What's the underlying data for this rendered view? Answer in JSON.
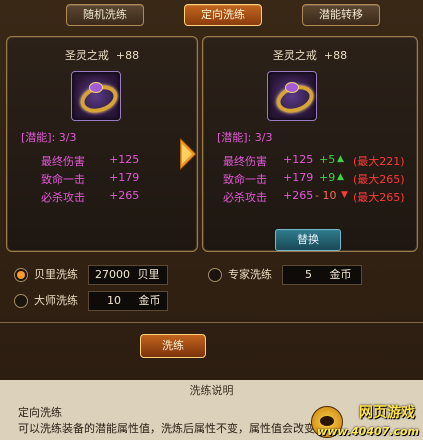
{
  "tabs": [
    {
      "label": "随机洗练",
      "active": false
    },
    {
      "label": "定向洗练",
      "active": true
    },
    {
      "label": "潜能转移",
      "active": false
    }
  ],
  "left_panel": {
    "title": "圣灵之戒",
    "level": "+88",
    "potential": "[潜能]: 3/3",
    "stats": [
      {
        "name": "最终伤害",
        "value": "+125"
      },
      {
        "name": "致命一击",
        "value": "+179"
      },
      {
        "name": "必杀攻击",
        "value": "+265"
      }
    ]
  },
  "right_panel": {
    "title": "圣灵之戒",
    "level": "+88",
    "potential": "[潜能]: 3/3",
    "stats": [
      {
        "name": "最终伤害",
        "value": "+125",
        "delta": "+5",
        "direction": "up",
        "max": "(最大221)"
      },
      {
        "name": "致命一击",
        "value": "+179",
        "delta": "+9",
        "direction": "up",
        "max": "(最大265)"
      },
      {
        "name": "必杀攻击",
        "value": "+265",
        "delta": "- 10",
        "direction": "down",
        "max": "(最大265)"
      }
    ],
    "swap_label": "替换"
  },
  "options": {
    "shell": {
      "label": "贝里洗练",
      "amount": "27000",
      "unit": "贝里",
      "selected": true
    },
    "expert": {
      "label": "专家洗练",
      "amount": "5",
      "unit": "金币",
      "selected": false
    },
    "master": {
      "label": "大师洗练",
      "amount": "10",
      "unit": "金币",
      "selected": false
    }
  },
  "wash_label": "洗练",
  "description": {
    "title": "洗练说明",
    "subtitle": "定向洗练",
    "text": "可以洗练装备的潜能属性值，洗炼后属性不变，属性值会改变。"
  },
  "watermark": {
    "title": "网页游戏",
    "url": "www.40407.com"
  },
  "icons": {
    "arrow": "right-arrow-icon",
    "item": "ring-icon"
  },
  "colors": {
    "accent": "#c2651d",
    "stat": "#e25ad6",
    "up": "#3ed24a",
    "down": "#ff3a3a"
  }
}
